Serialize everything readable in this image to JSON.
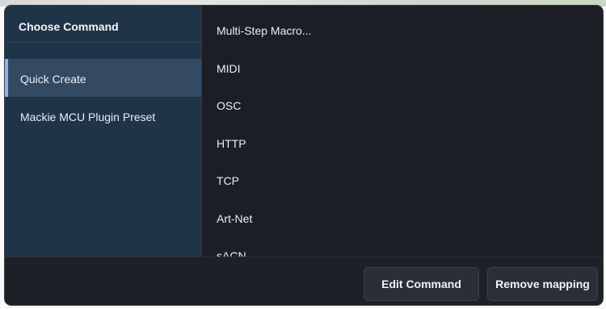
{
  "sidebar": {
    "title": "Choose Command",
    "items": [
      {
        "label": "Quick Create",
        "active": true
      },
      {
        "label": "Mackie MCU Plugin Preset",
        "active": false
      }
    ]
  },
  "commands": [
    "Multi-Step Macro...",
    "MIDI",
    "OSC",
    "HTTP",
    "TCP",
    "Art-Net",
    "sACN"
  ],
  "footer": {
    "edit_label": "Edit Command",
    "remove_label": "Remove mapping"
  },
  "colors": {
    "sidebar_bg": "#203448",
    "active_item_bg": "#344a62",
    "accent": "#86b8e8",
    "main_bg": "#1b1e25"
  }
}
